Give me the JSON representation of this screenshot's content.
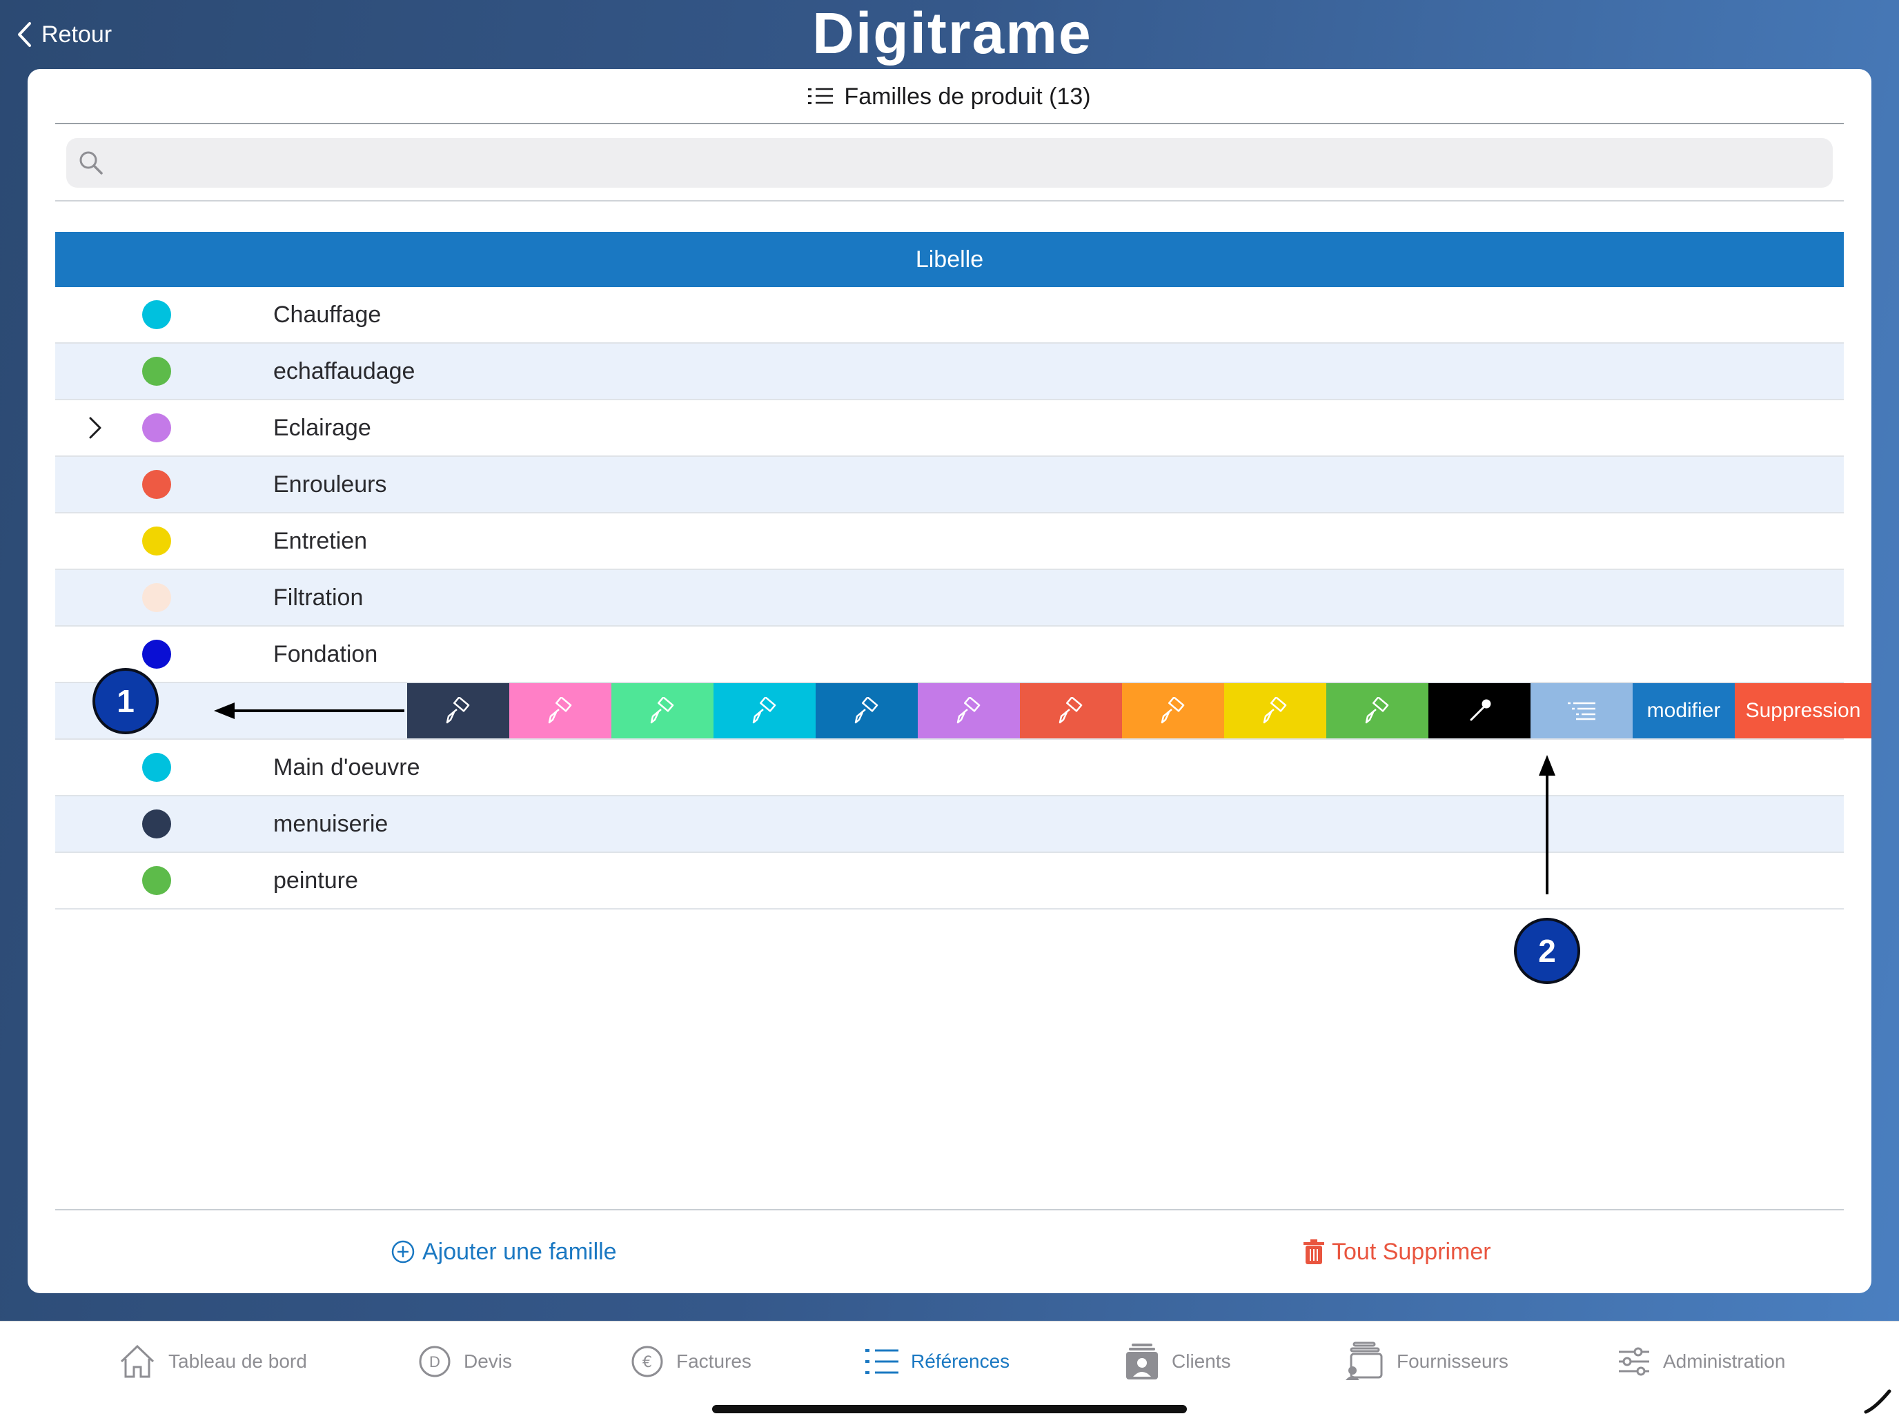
{
  "app": {
    "back_label": "Retour",
    "logo_text": "Digitrame"
  },
  "header": {
    "title": "Familles de produit (13)"
  },
  "search": {
    "placeholder": ""
  },
  "table": {
    "column": "Libelle",
    "rows": [
      {
        "label": "Chauffage",
        "color": "#00c1de",
        "chevron": false
      },
      {
        "label": "echaffaudage",
        "color": "#5dbb4a",
        "chevron": false
      },
      {
        "label": "Eclairage",
        "color": "#c47ae8",
        "chevron": true
      },
      {
        "label": "Enrouleurs",
        "color": "#ee5a43",
        "chevron": false
      },
      {
        "label": "Entretien",
        "color": "#f2d500",
        "chevron": false
      },
      {
        "label": "Filtration",
        "color": "#fbe6d9",
        "chevron": false
      },
      {
        "label": "Fondation",
        "color": "#0a0fd4",
        "chevron": false
      },
      {
        "label": "",
        "color": "",
        "chevron": false
      },
      {
        "label": "Main d'oeuvre",
        "color": "#00c1de",
        "chevron": false
      },
      {
        "label": "menuiserie",
        "color": "#2c3a55",
        "chevron": false
      },
      {
        "label": "peinture",
        "color": "#5dbb4a",
        "chevron": false
      }
    ]
  },
  "swipe_actions": {
    "colors": [
      "#2e3c57",
      "#ff7fc6",
      "#4fe697",
      "#00c1de",
      "#0a72b5",
      "#c47ae8",
      "#ec5a43",
      "#ff9b23",
      "#f2d500",
      "#5dbb4a"
    ],
    "eyedropper_bg": "#000000",
    "list_bg": "#92b9e3",
    "modify_label": "modifier",
    "modify_bg": "#1a78c2",
    "delete_label": "Suppression",
    "delete_bg": "#f4583d"
  },
  "annotations": {
    "badge_1": "1",
    "badge_2": "2"
  },
  "footer": {
    "add_label": "Ajouter une famille",
    "delete_all_label": "Tout Supprimer"
  },
  "tabbar": {
    "items": [
      {
        "label": "Tableau de bord",
        "icon": "home-icon"
      },
      {
        "label": "Devis",
        "icon": "devis-icon"
      },
      {
        "label": "Factures",
        "icon": "euro-icon"
      },
      {
        "label": "Références",
        "icon": "list-icon",
        "active": true
      },
      {
        "label": "Clients",
        "icon": "clients-icon"
      },
      {
        "label": "Fournisseurs",
        "icon": "suppliers-icon"
      },
      {
        "label": "Administration",
        "icon": "sliders-icon"
      }
    ]
  },
  "colors": {
    "accent": "#1a78c2",
    "danger": "#e9553f"
  }
}
